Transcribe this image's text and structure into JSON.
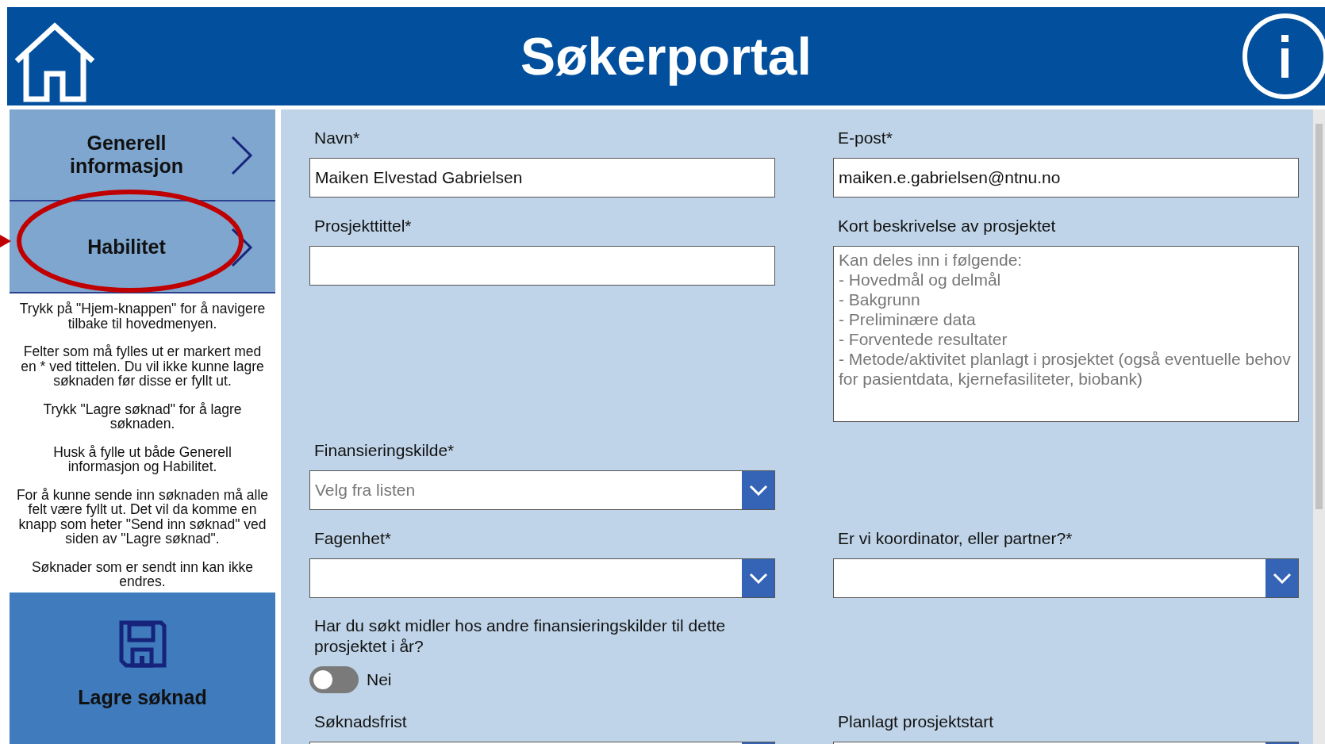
{
  "header": {
    "title": "Søkerportal"
  },
  "sidebar": {
    "items": [
      {
        "label": "Generell informasjon"
      },
      {
        "label": "Habilitet"
      }
    ],
    "help_paragraphs": [
      "Trykk på \"Hjem-knappen\" for å navigere tilbake til hovedmenyen.",
      "Felter som må fylles ut er markert med en * ved tittelen. Du vil ikke kunne lagre søknaden før disse er fyllt ut.",
      "Trykk \"Lagre søknad\" for å lagre søknaden.",
      "Husk å fylle ut både Generell informasjon og Habilitet.",
      "For å kunne sende inn søknaden må alle felt være fyllt ut. Det vil da komme en knapp som heter \"Send inn søknad\" ved siden av \"Lagre søknad\".",
      "Søknader som er sendt inn kan ikke endres."
    ],
    "save_button": {
      "label": "Lagre søknad"
    }
  },
  "form": {
    "rows": [
      [
        {
          "kind": "text",
          "label": "Navn*",
          "value": "Maiken Elvestad Gabrielsen"
        },
        {
          "kind": "text",
          "label": "E-post*",
          "value": "maiken.e.gabrielsen@ntnu.no"
        }
      ],
      [
        {
          "kind": "text",
          "label": "Prosjekttittel*"
        },
        {
          "kind": "textarea",
          "label": "Kort beskrivelse av prosjektet",
          "placeholder": "Kan deles inn i følgende:\n- Hovedmål og delmål\n- Bakgrunn\n- Preliminære data\n- Forventede resultater\n- Metode/aktivitet planlagt i prosjektet (også eventuelle behov for pasientdata, kjernefasiliteter, biobank)"
        }
      ],
      [
        {
          "kind": "dropdown",
          "label": "Finansieringskilde*",
          "placeholder": "Velg fra listen"
        }
      ],
      [
        {
          "kind": "dropdown",
          "label": "Fagenhet*"
        },
        {
          "kind": "dropdown",
          "label": "Er vi koordinator, eller partner?*"
        }
      ],
      [
        {
          "kind": "toggle",
          "label": "Har du søkt midler hos andre finansieringskilder til dette prosjektet i år?",
          "on": false,
          "state_label": "Nei"
        }
      ],
      [
        {
          "kind": "dropdown",
          "label": "Søknadsfrist"
        },
        {
          "kind": "dropdown",
          "label": "Planlagt prosjektstart"
        }
      ]
    ]
  }
}
